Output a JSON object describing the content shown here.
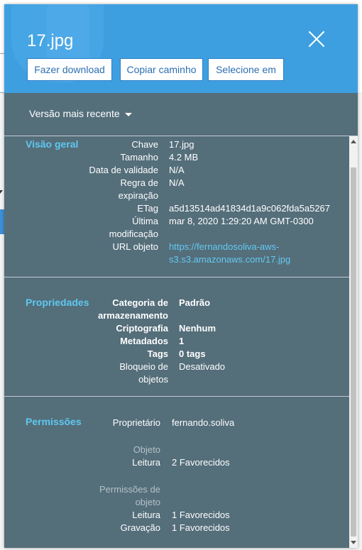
{
  "file": {
    "title": "17.jpg"
  },
  "actions": {
    "download": "Fazer download",
    "copy_path": "Copiar caminho",
    "select_in": "Selecione em"
  },
  "version": {
    "label": "Versão mais recente"
  },
  "overview": {
    "title": "Visão geral",
    "rows": [
      {
        "label": "Chave",
        "value": "17.jpg"
      },
      {
        "label": "Tamanho",
        "value": "4.2 MB"
      },
      {
        "label": "Data de validade",
        "value": "N/A"
      },
      {
        "label": "Regra de",
        "label2": "expiração",
        "value": "N/A"
      },
      {
        "label": "ETag",
        "value": "a5d13514ad41834d1a9c062fda5a5267"
      },
      {
        "label": "Última",
        "label2": "modificação",
        "value": "mar 8, 2020 1:29:20 AM GMT-0300"
      },
      {
        "label": "URL objeto",
        "value": "https://fernandosoliva-aws-",
        "value2": "s3.s3.amazonaws.com/17.jpg"
      }
    ]
  },
  "properties": {
    "title": "Propriedades",
    "rows": [
      {
        "label": "Categoria de",
        "label2": "armazenamento",
        "value": "Padrão"
      },
      {
        "label": "Criptografia",
        "value": "Nenhum"
      },
      {
        "label": "Metadados",
        "value": "1"
      },
      {
        "label": "Tags",
        "value": "0 tags"
      },
      {
        "label": "Bloqueio de",
        "label2": "objetos",
        "value": "Desativado"
      }
    ]
  },
  "permissions": {
    "title": "Permissões",
    "owner_label": "Proprietário",
    "owner_value": "fernando.soliva",
    "object_heading": "Objeto",
    "object_read_label": "Leitura",
    "object_read_value": "2 Favorecidos",
    "perm_heading": "Permissões de",
    "perm_heading2": "objeto",
    "perm_read_label": "Leitura",
    "perm_read_value": "1 Favorecidos",
    "perm_write_label": "Gravação",
    "perm_write_value": "1 Favorecidos"
  },
  "colors": {
    "header": "#3e9fe0",
    "panel": "#546e7a",
    "section_title": "#5fc8f0",
    "link": "#64c9f1"
  }
}
